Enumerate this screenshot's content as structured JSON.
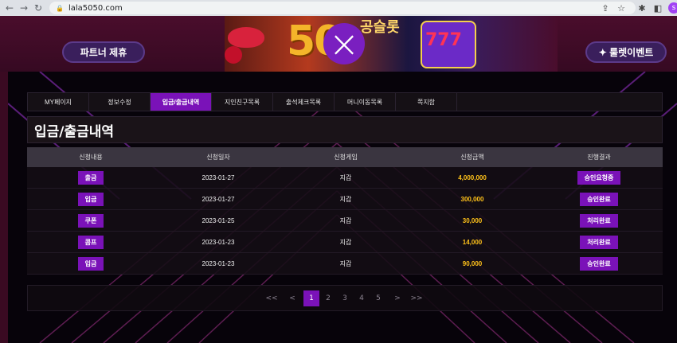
{
  "browser": {
    "url": "lala5050.com",
    "nav_back": "←",
    "nav_forward": "→",
    "reload": "↻",
    "lock": "🔒",
    "share_icon": "⇪",
    "star_icon": "☆",
    "ext_icon": "✱",
    "side_icon": "◧",
    "profile": "s"
  },
  "header": {
    "partner_button": "파트너 제휴",
    "roulette_button": "✦ 룰렛이벤트",
    "banner_text": "50",
    "banner_text2": "공슬롯",
    "slot_text": "777",
    "close_symbol": "×"
  },
  "tabs": [
    {
      "label": "MY페이지",
      "active": false
    },
    {
      "label": "정보수정",
      "active": false
    },
    {
      "label": "입금/출금내역",
      "active": true
    },
    {
      "label": "지인친구목록",
      "active": false
    },
    {
      "label": "출석체크목록",
      "active": false
    },
    {
      "label": "머니이동목록",
      "active": false
    },
    {
      "label": "쪽지함",
      "active": false
    }
  ],
  "page_title": "입금/출금내역",
  "table": {
    "headers": [
      "신청내용",
      "신청일자",
      "신청게임",
      "신청금액",
      "진행결과"
    ],
    "rows": [
      {
        "type": "출금",
        "date": "2023-01-27",
        "game": "지갑",
        "amount": "4,000,000",
        "status": "승인요청중"
      },
      {
        "type": "입금",
        "date": "2023-01-27",
        "game": "지갑",
        "amount": "300,000",
        "status": "승인완료"
      },
      {
        "type": "쿠폰",
        "date": "2023-01-25",
        "game": "지갑",
        "amount": "30,000",
        "status": "처리완료"
      },
      {
        "type": "콤프",
        "date": "2023-01-23",
        "game": "지갑",
        "amount": "14,000",
        "status": "처리완료"
      },
      {
        "type": "입금",
        "date": "2023-01-23",
        "game": "지갑",
        "amount": "90,000",
        "status": "승인완료"
      }
    ]
  },
  "pagination": {
    "first": "<<",
    "prev": "<",
    "pages": [
      "1",
      "2",
      "3",
      "4",
      "5"
    ],
    "current": "1",
    "next": ">",
    "last": ">>"
  },
  "colors": {
    "accent": "#7a12b8",
    "amount": "#ffc21a"
  }
}
